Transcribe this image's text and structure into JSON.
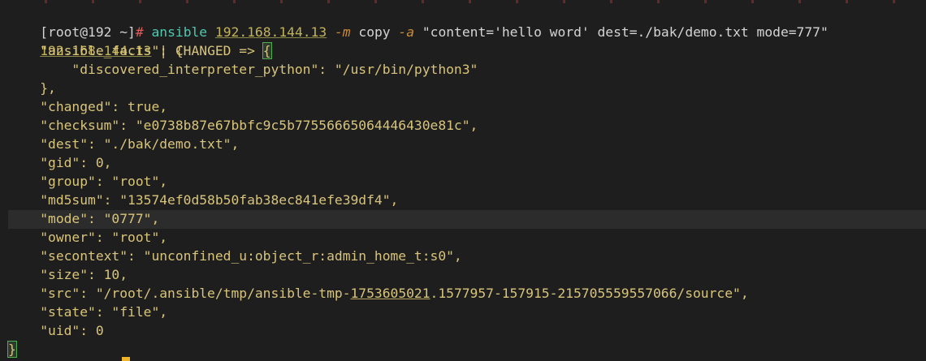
{
  "prompt": {
    "user_host": "[root@192 ~]",
    "symbol": "#"
  },
  "command": {
    "program": "ansible",
    "host": "192.168.144.13",
    "module_flag": "-m",
    "module": "copy",
    "args_flag": "-a",
    "args": "\"content='hello word' dest=./bak/demo.txt mode=777\""
  },
  "result": {
    "host": "192.168.144.13",
    "separator": " | CHANGED => ",
    "open_brace": "{",
    "close_brace": "}",
    "lines": [
      "    \"ansible_facts\": {",
      "        \"discovered_interpreter_python\": \"/usr/bin/python3\"",
      "    },",
      "    \"changed\": true,",
      "    \"checksum\": \"e0738b87e67bbfc9c5b77556665064446430e81c\",",
      "    \"dest\": \"./bak/demo.txt\",",
      "    \"gid\": 0,",
      "    \"group\": \"root\",",
      "    \"md5sum\": \"13574ef0d58b50fab38ec841efe39df4\",",
      "    \"mode\": \"0777\",",
      "    \"owner\": \"root\",",
      "    \"secontext\": \"unconfined_u:object_r:admin_home_t:s0\",",
      "    \"size\": 10,",
      "    \"src\": \"/root/.ansible/tmp/ansible-tmp-",
      "    \"state\": \"file\",",
      "    \"uid\": 0"
    ],
    "src_underlined": "1753605021",
    "src_rest": ".1577957-157915-215705559557066/source\","
  },
  "colors": {
    "background": "#1e1e1e",
    "highlight_row": "#2c2c2c",
    "prompt_hash": "#e65a5a",
    "command": "#4ec9b0",
    "ip": "#c3b45a",
    "option": "#cc8a3a",
    "output": "#d8c47a",
    "cursor": "#f0b429"
  }
}
